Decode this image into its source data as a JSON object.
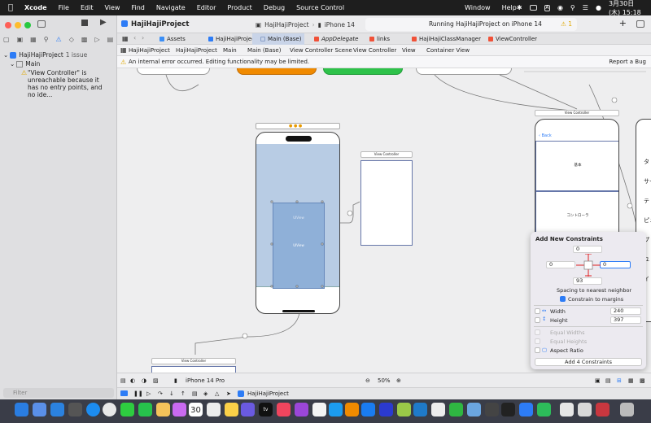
{
  "menubar": {
    "items": [
      "Xcode",
      "File",
      "Edit",
      "View",
      "Find",
      "Navigate",
      "Editor",
      "Product",
      "Debug",
      "Source Control",
      "Window",
      "Help"
    ],
    "input_mode": "A",
    "clock": "3月30日(木) 15:18"
  },
  "sidebar": {
    "project_issue": "HajiHajiProject",
    "issue_count": "1 issue",
    "group": "Main",
    "issue_text": "\"View Controller\" is unreachable because it has no entry points, and no ide...",
    "filter_placeholder": "Filter"
  },
  "toolbar": {
    "project_title": "HajiHajiProject",
    "scheme": "HajiHajiProject",
    "destination": "iPhone 14",
    "status": "Running HajiHajiProject on iPhone 14",
    "warning_count": "1"
  },
  "tabs": [
    "Assets",
    "HajiHajiProject",
    "Main (Base)",
    "AppDelegate",
    "links",
    "HajiHajiClassManager",
    "ViewController"
  ],
  "breadcrumb": [
    "HajiHajiProject",
    "HajiHajiProject",
    "Main",
    "Main (Base)",
    "View Controller Scene",
    "View Controller",
    "View",
    "Container View"
  ],
  "warning_bar": {
    "message": "An internal error occurred. Editing functionality may be limited.",
    "report": "Report a Bug"
  },
  "canvas": {
    "vc_title": "View Controller",
    "back_label": "Back",
    "cell_1": "基本",
    "cell_2": "コントローラ",
    "side_labels": [
      "タ",
      "サー",
      "テ",
      "ピュ",
      "プ",
      "ユ",
      "イ"
    ],
    "container_label": "UIView",
    "container_sublabel": "UIView"
  },
  "constraints": {
    "title": "Add New Constraints",
    "top": "0",
    "left": "0",
    "right": "0",
    "bottom": "93",
    "spacing_label": "Spacing to nearest neighbor",
    "margins_label": "Constrain to margins",
    "width_label": "Width",
    "width_value": "240",
    "height_label": "Height",
    "height_value": "397",
    "equal_widths": "Equal Widths",
    "equal_heights": "Equal Heights",
    "aspect_ratio": "Aspect Ratio",
    "add_button": "Add 4 Constraints"
  },
  "bottombar": {
    "device": "iPhone 14 Pro",
    "zoom": "50%"
  },
  "debugbar": {
    "target": "HajiHajiProject"
  },
  "dock": {
    "calendar_day": "30",
    "tv_label": "tv"
  }
}
